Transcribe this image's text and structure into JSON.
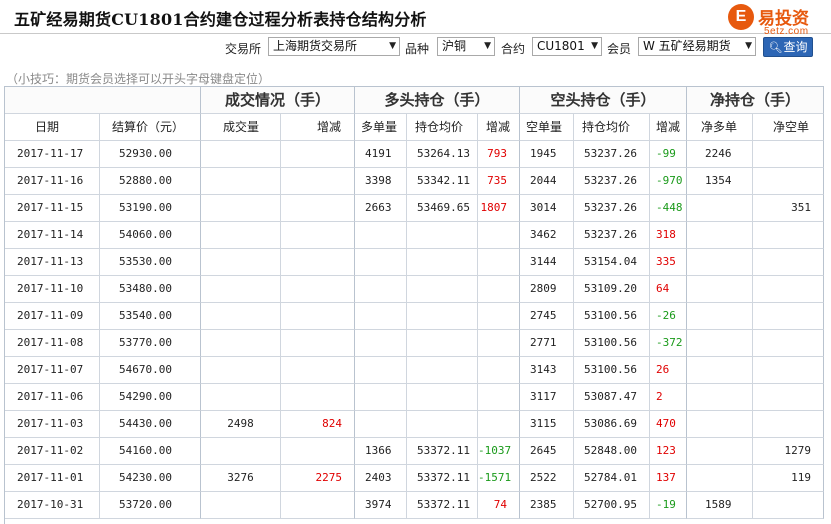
{
  "title": "五矿经易期货CU1801合约建仓过程分析表持仓结构分析",
  "logo": {
    "mark": "E",
    "word": "易投资",
    "sub": "5etz.com"
  },
  "filters": {
    "exchange_label": "交易所",
    "exchange_value": "上海期货交易所",
    "variety_label": "品种",
    "variety_value": "沪铜",
    "contract_label": "合约",
    "contract_value": "CU1801",
    "member_label": "会员",
    "member_value": "W 五矿经易期货",
    "search_label": "查询"
  },
  "tip": "（小技巧：期货会员选择可以开头字母键盘定位）",
  "table": {
    "group_headers": [
      "",
      "成交情况（手）",
      "多头持仓（手）",
      "空头持仓（手）",
      "净持仓（手）"
    ],
    "columns": [
      "日期",
      "结算价（元）",
      "成交量",
      "增减",
      "多单量",
      "持仓均价",
      "增减",
      "空单量",
      "持仓均价",
      "增减",
      "净多单",
      "净空单"
    ],
    "rows": [
      [
        "2017-11-17",
        "52930.00",
        "",
        "",
        "4191",
        "53264.13",
        "793",
        "1945",
        "53237.26",
        "-99",
        "2246",
        ""
      ],
      [
        "2017-11-16",
        "52880.00",
        "",
        "",
        "3398",
        "53342.11",
        "735",
        "2044",
        "53237.26",
        "-970",
        "1354",
        ""
      ],
      [
        "2017-11-15",
        "53190.00",
        "",
        "",
        "2663",
        "53469.65",
        "1807",
        "3014",
        "53237.26",
        "-448",
        "",
        "351"
      ],
      [
        "2017-11-14",
        "54060.00",
        "",
        "",
        "",
        "",
        "",
        "3462",
        "53237.26",
        "318",
        "",
        ""
      ],
      [
        "2017-11-13",
        "53530.00",
        "",
        "",
        "",
        "",
        "",
        "3144",
        "53154.04",
        "335",
        "",
        ""
      ],
      [
        "2017-11-10",
        "53480.00",
        "",
        "",
        "",
        "",
        "",
        "2809",
        "53109.20",
        "64",
        "",
        ""
      ],
      [
        "2017-11-09",
        "53540.00",
        "",
        "",
        "",
        "",
        "",
        "2745",
        "53100.56",
        "-26",
        "",
        ""
      ],
      [
        "2017-11-08",
        "53770.00",
        "",
        "",
        "",
        "",
        "",
        "2771",
        "53100.56",
        "-372",
        "",
        ""
      ],
      [
        "2017-11-07",
        "54670.00",
        "",
        "",
        "",
        "",
        "",
        "3143",
        "53100.56",
        "26",
        "",
        ""
      ],
      [
        "2017-11-06",
        "54290.00",
        "",
        "",
        "",
        "",
        "",
        "3117",
        "53087.47",
        "2",
        "",
        ""
      ],
      [
        "2017-11-03",
        "54430.00",
        "2498",
        "824",
        "",
        "",
        "",
        "3115",
        "53086.69",
        "470",
        "",
        ""
      ],
      [
        "2017-11-02",
        "54160.00",
        "",
        "",
        "1366",
        "53372.11",
        "-1037",
        "2645",
        "52848.00",
        "123",
        "",
        "1279"
      ],
      [
        "2017-11-01",
        "54230.00",
        "3276",
        "2275",
        "2403",
        "53372.11",
        "-1571",
        "2522",
        "52784.01",
        "137",
        "",
        "119"
      ],
      [
        "2017-10-31",
        "53720.00",
        "",
        "",
        "3974",
        "53372.11",
        "74",
        "2385",
        "52700.95",
        "-19",
        "1589",
        ""
      ]
    ]
  },
  "colors": {
    "increase": "#e00000",
    "decrease": "#1a9a1a",
    "search_button": "#2d66b5",
    "brand": "#e7590e"
  }
}
